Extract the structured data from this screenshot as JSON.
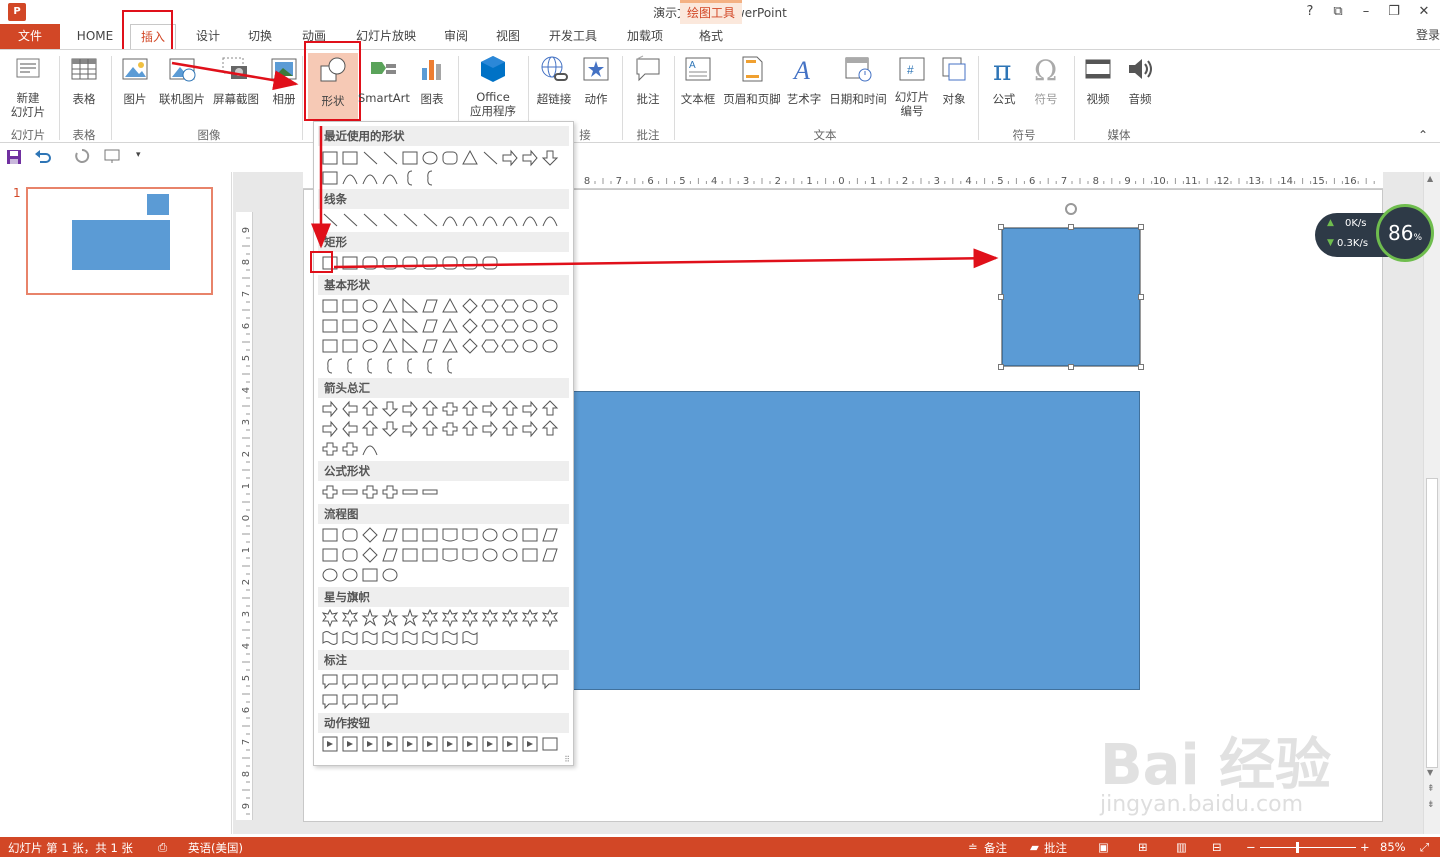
{
  "window": {
    "title": "演示文稿1 - PowerPoint",
    "app_icon": "P",
    "controls": {
      "help": "?",
      "ribbon_opts": "⧉",
      "minimize": "–",
      "maximize": "❐",
      "close": "✕"
    },
    "login": "登录"
  },
  "tabs": {
    "file": "文件",
    "items": [
      "HOME",
      "插入",
      "设计",
      "切换",
      "动画",
      "幻灯片放映",
      "审阅",
      "视图",
      "开发工具",
      "加载项"
    ],
    "context_label": "绘图工具",
    "context_tab": "格式"
  },
  "ribbon": {
    "new_slide": "新建\n幻灯片",
    "table": "表格",
    "picture": "图片",
    "online_picture": "联机图片",
    "screenshot": "屏幕截图",
    "album": "相册",
    "shapes": "形状",
    "smartart": "SmartArt",
    "chart": "图表",
    "office_apps_1": "Office",
    "office_apps_2": "应用程序",
    "hyperlink": "超链接",
    "action": "动作",
    "comment": "批注",
    "textbox": "文本框",
    "header_footer": "页眉和页脚",
    "wordart": "艺术字",
    "datetime": "日期和时间",
    "slide_number_1": "幻灯片",
    "slide_number_2": "编号",
    "object": "对象",
    "equation": "公式",
    "symbol": "符号",
    "video": "视频",
    "audio": "音频",
    "groups": {
      "slides": "幻灯片",
      "tables": "表格",
      "images": "图像",
      "links": "接",
      "comments": "批注",
      "text": "文本",
      "symbols": "符号",
      "media": "媒体"
    }
  },
  "shapes_menu": {
    "categories": [
      "最近使用的形状",
      "线条",
      "矩形",
      "基本形状",
      "箭头总汇",
      "公式形状",
      "流程图",
      "星与旗帜",
      "标注",
      "动作按钮"
    ]
  },
  "slide_panel": {
    "slide_number": "1"
  },
  "ruler": {
    "h_ticks": [
      "8",
      "7",
      "6",
      "5",
      "4",
      "3",
      "2",
      "1",
      "0",
      "1",
      "2",
      "3",
      "4",
      "5",
      "6",
      "7",
      "8",
      "9",
      "10",
      "11",
      "12",
      "13",
      "14",
      "15",
      "16"
    ],
    "v_ticks": [
      "9",
      "8",
      "7",
      "6",
      "5",
      "4",
      "3",
      "2",
      "1",
      "0",
      "1",
      "2",
      "3",
      "4",
      "5",
      "6",
      "7",
      "8",
      "9"
    ]
  },
  "status": {
    "slide_info": "幻灯片 第 1 张，共 1 张",
    "language": "英语(美国)",
    "notes": "备注",
    "comments": "批注",
    "zoom": "85%"
  },
  "speed_widget": {
    "up": "0K/s",
    "down": "0.3K/s",
    "percent": "86",
    "percent_sign": "%"
  },
  "watermark": {
    "brand": "Bai  经验",
    "url": "jingyan.baidu.com"
  },
  "colors": {
    "accent": "#d24726",
    "shape_fill": "#5b9bd5",
    "highlight": "#e0101a"
  }
}
